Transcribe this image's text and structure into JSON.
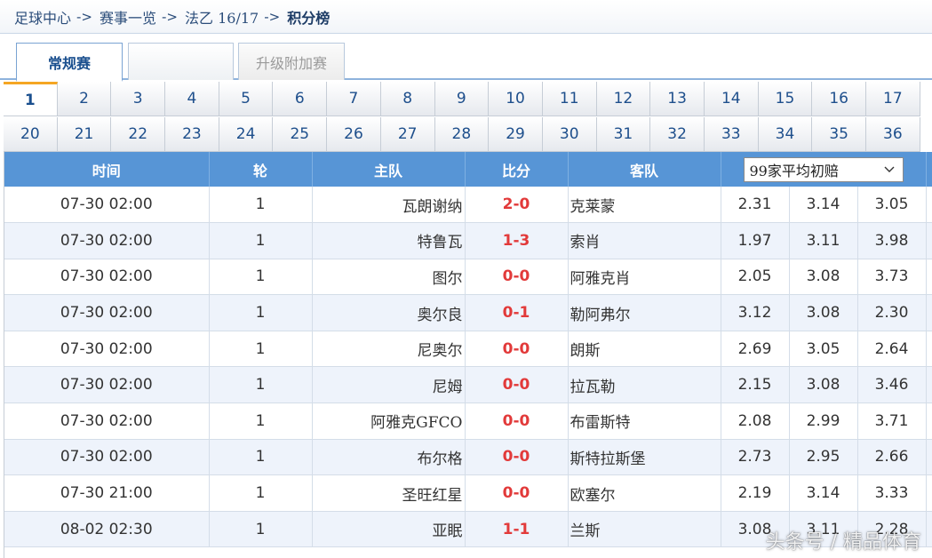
{
  "breadcrumb": {
    "items": [
      "足球中心",
      "赛事一览",
      "法乙 16/17",
      "积分榜"
    ],
    "separator": "->"
  },
  "tabs": [
    {
      "label": "常规赛",
      "active": true
    },
    {
      "label": "",
      "active": false
    },
    {
      "label": "升级附加赛",
      "active": false
    }
  ],
  "rounds": {
    "row1": [
      "1",
      "2",
      "3",
      "4",
      "5",
      "6",
      "7",
      "8",
      "9",
      "10",
      "11",
      "12",
      "13",
      "14",
      "15",
      "16",
      "17"
    ],
    "row2": [
      "20",
      "21",
      "22",
      "23",
      "24",
      "25",
      "26",
      "27",
      "28",
      "29",
      "30",
      "31",
      "32",
      "33",
      "34",
      "35",
      "36"
    ],
    "active": "1"
  },
  "table": {
    "headers": {
      "time": "时间",
      "round": "轮",
      "home": "主队",
      "score": "比分",
      "away": "客队"
    },
    "odds_select": {
      "value": "99家平均初赔"
    },
    "rows": [
      {
        "time": "07-30 02:00",
        "round": "1",
        "home": "瓦朗谢纳",
        "score": "2-0",
        "away": "克莱蒙",
        "o1": "2.31",
        "o2": "3.14",
        "o3": "3.05"
      },
      {
        "time": "07-30 02:00",
        "round": "1",
        "home": "特鲁瓦",
        "score": "1-3",
        "away": "索肖",
        "o1": "1.97",
        "o2": "3.11",
        "o3": "3.98"
      },
      {
        "time": "07-30 02:00",
        "round": "1",
        "home": "图尔",
        "score": "0-0",
        "away": "阿雅克肖",
        "o1": "2.05",
        "o2": "3.08",
        "o3": "3.73"
      },
      {
        "time": "07-30 02:00",
        "round": "1",
        "home": "奥尔良",
        "score": "0-1",
        "away": "勒阿弗尔",
        "o1": "3.12",
        "o2": "3.08",
        "o3": "2.30"
      },
      {
        "time": "07-30 02:00",
        "round": "1",
        "home": "尼奥尔",
        "score": "0-0",
        "away": "朗斯",
        "o1": "2.69",
        "o2": "3.05",
        "o3": "2.64"
      },
      {
        "time": "07-30 02:00",
        "round": "1",
        "home": "尼姆",
        "score": "0-0",
        "away": "拉瓦勒",
        "o1": "2.15",
        "o2": "3.08",
        "o3": "3.46"
      },
      {
        "time": "07-30 02:00",
        "round": "1",
        "home": "阿雅克GFCO",
        "score": "0-0",
        "away": "布雷斯特",
        "o1": "2.08",
        "o2": "2.99",
        "o3": "3.71"
      },
      {
        "time": "07-30 02:00",
        "round": "1",
        "home": "布尔格",
        "score": "0-0",
        "away": "斯特拉斯堡",
        "o1": "2.73",
        "o2": "2.95",
        "o3": "2.66"
      },
      {
        "time": "07-30 21:00",
        "round": "1",
        "home": "圣旺红星",
        "score": "0-0",
        "away": "欧塞尔",
        "o1": "2.19",
        "o2": "3.14",
        "o3": "3.33"
      },
      {
        "time": "08-02 02:30",
        "round": "1",
        "home": "亚眠",
        "score": "1-1",
        "away": "兰斯",
        "o1": "3.08",
        "o2": "3.11",
        "o3": "2.28"
      }
    ]
  },
  "watermark": "头条号 / 精品体育",
  "colors": {
    "header_bg": "#5795d6",
    "score": "#e23a3a",
    "alt_row": "#eef3fb",
    "active_round_top": "#f5a623"
  },
  "icons": {
    "select": "chevron-down-icon"
  }
}
